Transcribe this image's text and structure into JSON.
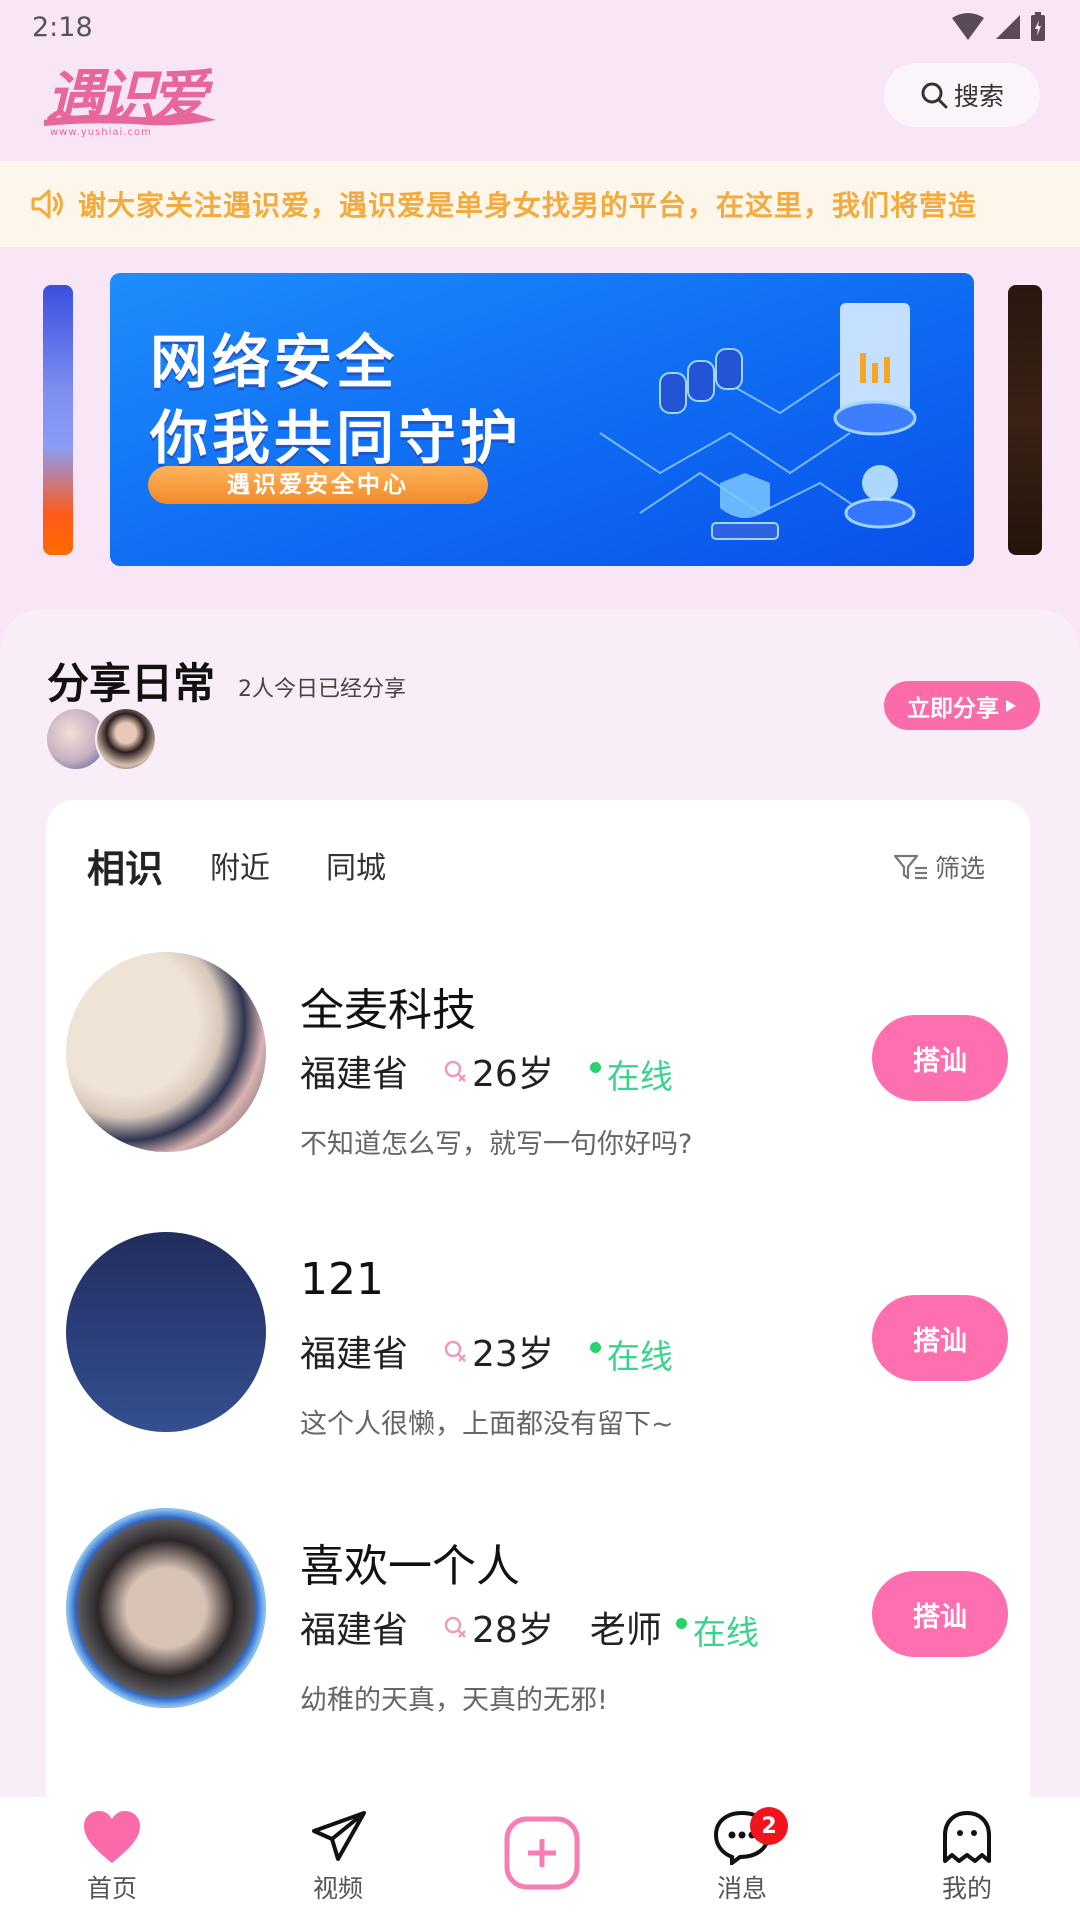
{
  "status_bar": {
    "time": "2:18",
    "icons": [
      "wifi-icon",
      "signal-icon",
      "battery-charging-icon"
    ]
  },
  "header": {
    "logo_text": "遇识爱",
    "logo_subtitle": "www.yushiai.com",
    "search_label": "搜索",
    "search_icon": "search-icon"
  },
  "notice": {
    "icon": "speaker-icon",
    "text": "谢大家关注遇识爱，遇识爱是单身女找男的平台，在这里，我们将营造"
  },
  "banner": {
    "line1": "网络安全",
    "line2": "你我共同守护",
    "cta": "遇识爱安全中心"
  },
  "share": {
    "title": "分享日常",
    "subtitle": "2人今日已经分享",
    "button_label": "立即分享"
  },
  "tabs": [
    {
      "label": "相识",
      "active": true
    },
    {
      "label": "附近",
      "active": false
    },
    {
      "label": "同城",
      "active": false
    }
  ],
  "filter_label": "筛选",
  "profiles": [
    {
      "name": "全麦科技",
      "province": "福建省",
      "age": "26岁",
      "job": "",
      "status": "在线",
      "bio": "不知道怎么写，就写一句你好吗?",
      "action": "搭讪"
    },
    {
      "name": "121",
      "province": "福建省",
      "age": "23岁",
      "job": "",
      "status": "在线",
      "bio": "这个人很懒，上面都没有留下~",
      "action": "搭讪"
    },
    {
      "name": "喜欢一个人",
      "province": "福建省",
      "age": "28岁",
      "job": "老师",
      "status": "在线",
      "bio": "幼稚的天真，天真的无邪!",
      "action": "搭讪"
    }
  ],
  "bottom_nav": [
    {
      "label": "首页",
      "icon": "heart-icon",
      "active": true
    },
    {
      "label": "视频",
      "icon": "paper-plane-icon",
      "active": false
    },
    {
      "label": "",
      "icon": "add-post-icon",
      "active": false
    },
    {
      "label": "消息",
      "icon": "chat-bubble-icon",
      "badge": "2",
      "active": false
    },
    {
      "label": "我的",
      "icon": "ghost-icon",
      "active": false
    }
  ],
  "colors": {
    "accent_pink": "#fd6fae",
    "notice_orange": "#f3ab3f",
    "online_green": "#3ad38a",
    "badge_red": "#f2141c",
    "page_bg": "#f8e6f6"
  }
}
